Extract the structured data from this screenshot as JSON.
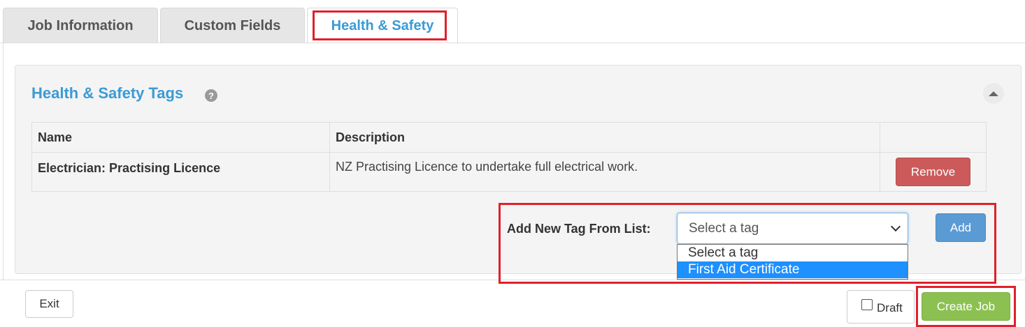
{
  "tabs": [
    {
      "label": "Job Information",
      "active": false
    },
    {
      "label": "Custom Fields",
      "active": false
    },
    {
      "label": "Health & Safety",
      "active": true
    }
  ],
  "section": {
    "title": "Health & Safety Tags",
    "help_icon": "question-icon",
    "collapse_icon": "caret-up-icon"
  },
  "table": {
    "columns": [
      "Name",
      "Description",
      ""
    ],
    "rows": [
      {
        "name": "Electrician: Practising Licence",
        "description": "NZ Practising Licence to undertake full electrical work.",
        "action_label": "Remove"
      }
    ]
  },
  "add_tag": {
    "label": "Add New Tag From List:",
    "select_value": "Select a tag",
    "options": [
      "Select a tag",
      "First Aid Certificate"
    ],
    "highlighted_option": "First Aid Certificate",
    "add_label": "Add"
  },
  "footer": {
    "exit_label": "Exit",
    "draft_label": "Draft",
    "draft_checked": false,
    "create_label": "Create Job"
  },
  "colors": {
    "accent": "#3a9bd5",
    "remove": "#cc5a5a",
    "add": "#5a9bd4",
    "create": "#8cc152",
    "annotation": "#e0202a",
    "highlight": "#1e90ff"
  }
}
